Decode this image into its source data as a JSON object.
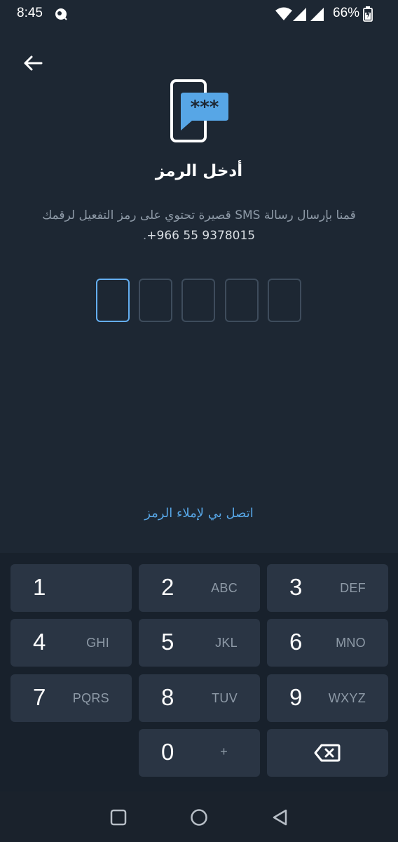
{
  "status_bar": {
    "time": "8:45",
    "battery": "66%"
  },
  "header": {
    "title": "أدخل الرمز"
  },
  "description": {
    "text": "قمنا بإرسال رسالة SMS قصيرة تحتوي على رمز التفعيل لرقمك",
    "phone": "+966 55 9378015",
    "suffix": "."
  },
  "code_input": {
    "length": 5,
    "values": [
      "",
      "",
      "",
      "",
      ""
    ]
  },
  "call_link": "اتصل بي لإملاء الرمز",
  "keypad": {
    "keys": [
      {
        "digit": "1",
        "letters": ""
      },
      {
        "digit": "2",
        "letters": "ABC"
      },
      {
        "digit": "3",
        "letters": "DEF"
      },
      {
        "digit": "4",
        "letters": "GHI"
      },
      {
        "digit": "5",
        "letters": "JKL"
      },
      {
        "digit": "6",
        "letters": "MNO"
      },
      {
        "digit": "7",
        "letters": "PQRS"
      },
      {
        "digit": "8",
        "letters": "TUV"
      },
      {
        "digit": "9",
        "letters": "WXYZ"
      },
      {
        "digit": "0",
        "letters": "+"
      }
    ]
  },
  "colors": {
    "background": "#1d2733",
    "accent": "#57a6e6",
    "key": "#2a3544"
  }
}
